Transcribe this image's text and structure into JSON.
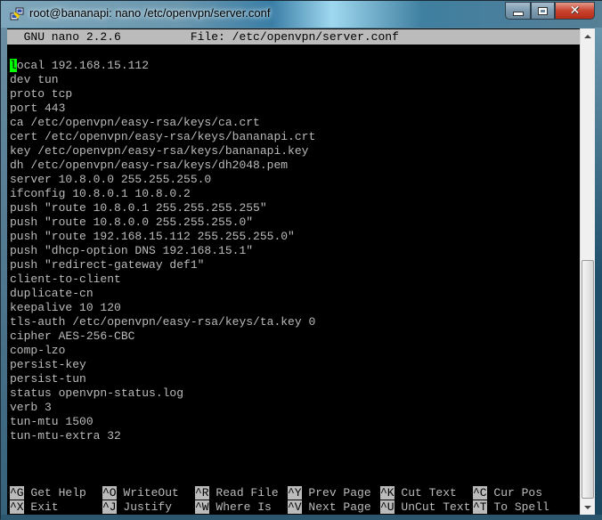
{
  "window": {
    "title": "root@bananapi: nano /etc/openvpn/server.conf",
    "controls": {
      "minimize": "minimize",
      "maximize": "maximize",
      "close": "close"
    }
  },
  "nano": {
    "version_label": "  GNU nano 2.2.6          File: /etc/openvpn/server.conf",
    "cursor_char": "l",
    "first_line_rest": "ocal 192.168.15.112",
    "lines": [
      "local 192.168.15.112",
      "dev tun",
      "proto tcp",
      "port 443",
      "ca /etc/openvpn/easy-rsa/keys/ca.crt",
      "cert /etc/openvpn/easy-rsa/keys/bananapi.crt",
      "key /etc/openvpn/easy-rsa/keys/bananapi.key",
      "dh /etc/openvpn/easy-rsa/keys/dh2048.pem",
      "server 10.8.0.0 255.255.255.0",
      "ifconfig 10.8.0.1 10.8.0.2",
      "push \"route 10.8.0.1 255.255.255.255\"",
      "push \"route 10.8.0.0 255.255.255.0\"",
      "push \"route 192.168.15.112 255.255.255.0\"",
      "push \"dhcp-option DNS 192.168.15.1\"",
      "push \"redirect-gateway def1\"",
      "client-to-client",
      "duplicate-cn",
      "keepalive 10 120",
      "tls-auth /etc/openvpn/easy-rsa/keys/ta.key 0",
      "cipher AES-256-CBC",
      "comp-lzo",
      "persist-key",
      "persist-tun",
      "status openvpn-status.log",
      "verb 3",
      "tun-mtu 1500",
      "tun-mtu-extra 32"
    ],
    "shortcuts_row1": [
      {
        "key": "^G",
        "label": " Get Help  "
      },
      {
        "key": "^O",
        "label": " WriteOut  "
      },
      {
        "key": "^R",
        "label": " Read File "
      },
      {
        "key": "^Y",
        "label": " Prev Page "
      },
      {
        "key": "^K",
        "label": " Cut Text  "
      },
      {
        "key": "^C",
        "label": " Cur Pos"
      }
    ],
    "shortcuts_row2": [
      {
        "key": "^X",
        "label": " Exit      "
      },
      {
        "key": "^J",
        "label": " Justify   "
      },
      {
        "key": "^W",
        "label": " Where Is  "
      },
      {
        "key": "^V",
        "label": " Next Page "
      },
      {
        "key": "^U",
        "label": " UnCut Text"
      },
      {
        "key": "^T",
        "label": " To Spell"
      }
    ]
  },
  "colors": {
    "terminal_bg": "#000000",
    "terminal_fg": "#bbbbbb",
    "cursor": "#00ff00",
    "close_button": "#c9432e"
  },
  "scroll": {
    "position_fraction": 0.48,
    "visible_fraction": 0.5
  }
}
